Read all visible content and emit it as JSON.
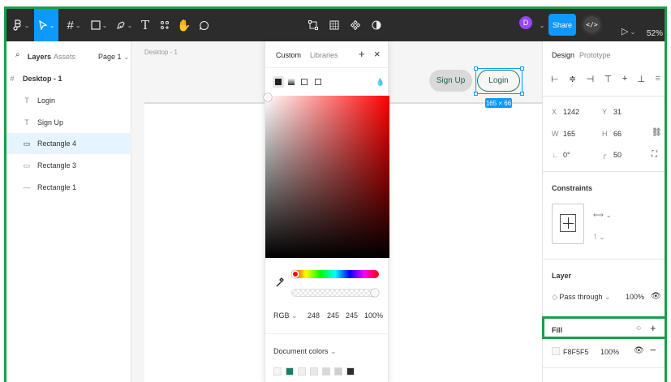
{
  "layers_panel": {
    "tab_layers": "Layers",
    "tab_assets": "Assets",
    "page_selector": "Page 1",
    "items": [
      {
        "label": "Desktop - 1",
        "icon": "#"
      },
      {
        "label": "Login",
        "icon": "T"
      },
      {
        "label": "Sign Up",
        "icon": "T"
      },
      {
        "label": "Rectangle 4",
        "icon": "▭"
      },
      {
        "label": "Rectangle 3",
        "icon": "▭"
      },
      {
        "label": "Rectangle 1",
        "icon": "—"
      }
    ]
  },
  "toolbar": {
    "avatar_letter": "D",
    "share_label": "Share",
    "dev_mode_label": "</>",
    "zoom": "52%",
    "text_tool": "T"
  },
  "canvas": {
    "frame_label": "Desktop - 1",
    "signup_label": "Sign Up",
    "login_label": "Login",
    "dimensions": "165 × 66"
  },
  "color_picker": {
    "tab_custom": "Custom",
    "tab_libraries": "Libraries",
    "mode": "RGB",
    "r": "248",
    "g": "245",
    "b": "245",
    "alpha": "100%",
    "document_colors_label": "Document colors",
    "document_colors": [
      "#f5f5f5",
      "#1f7a68",
      "#f0f0f0",
      "#e8e8e8",
      "#d9d9d9",
      "#cfcfcf",
      "#2c2c2c"
    ]
  },
  "design_panel": {
    "tab_design": "Design",
    "tab_prototype": "Prototype",
    "x_label": "X",
    "x_value": "1242",
    "y_label": "Y",
    "y_value": "31",
    "w_label": "W",
    "w_value": "165",
    "h_label": "H",
    "h_value": "66",
    "rotation": "0°",
    "radius": "50",
    "constraints_title": "Constraints",
    "layer_title": "Layer",
    "blend_mode": "Pass through",
    "layer_opacity": "100%",
    "fill_title": "Fill",
    "fill_hex": "F8F5F5",
    "fill_opacity": "100%",
    "fill_color": "#F8F5F5"
  }
}
